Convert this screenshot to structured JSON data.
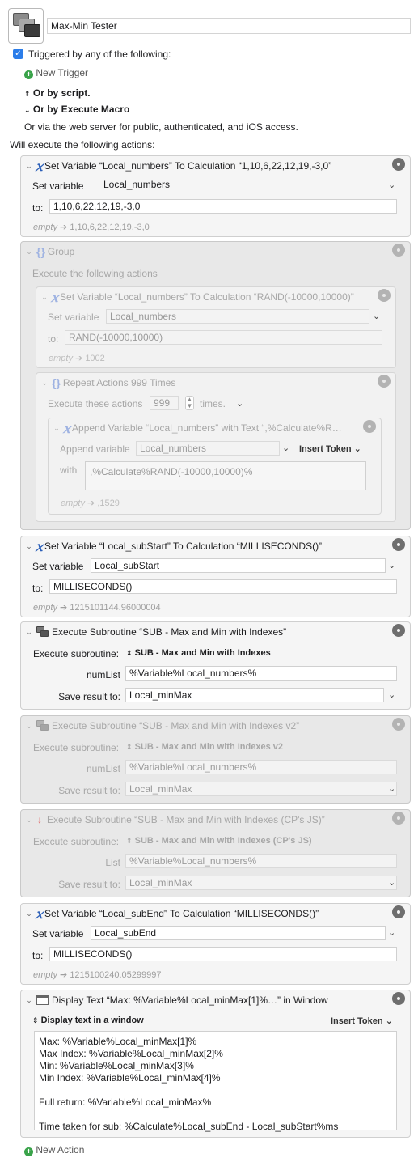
{
  "macro": {
    "name": "Max-Min Tester"
  },
  "triggers": {
    "header": "Triggered by any of the following:",
    "new_trigger": "New Trigger",
    "by_script": "Or by script.",
    "by_execute_macro": "Or by Execute Macro",
    "web_server": "Or via the web server for public, authenticated, and iOS access."
  },
  "actions_header": "Will execute the following actions:",
  "a1": {
    "title": "Set Variable “Local_numbers” To Calculation “1,10,6,22,12,19,-3,0”",
    "set_variable_label": "Set variable",
    "variable": "Local_numbers",
    "to_label": "to:",
    "value": "1,10,6,22,12,19,-3,0",
    "result_prefix": "empty",
    "result": "1,10,6,22,12,19,-3,0"
  },
  "group": {
    "title": "Group",
    "subtitle": "Execute the following actions",
    "g1": {
      "title": "Set Variable “Local_numbers” To Calculation “RAND(-10000,10000)”",
      "set_variable_label": "Set variable",
      "variable": "Local_numbers",
      "to_label": "to:",
      "value": "RAND(-10000,10000)",
      "result_prefix": "empty",
      "result": "1002"
    },
    "repeat": {
      "title": "Repeat Actions 999 Times",
      "label": "Execute these actions",
      "count": "999",
      "times": "times.",
      "append": {
        "title": "Append Variable “Local_numbers” with Text “,%Calculate%R…",
        "append_label": "Append variable",
        "variable": "Local_numbers",
        "insert_token": "Insert Token",
        "with_label": "with",
        "text": ",%Calculate%RAND(-10000,10000)%",
        "result_prefix": "empty",
        "result": ",1529"
      }
    }
  },
  "a3": {
    "title": "Set Variable “Local_subStart” To Calculation “MILLISECONDS()”",
    "set_variable_label": "Set variable",
    "variable": "Local_subStart",
    "to_label": "to:",
    "value": "MILLISECONDS()",
    "result_prefix": "empty",
    "result": "1215101144.96000004"
  },
  "a4": {
    "title": "Execute Subroutine “SUB - Max and Min with Indexes”",
    "exec_label": "Execute subroutine:",
    "subroutine": "SUB - Max and Min with Indexes",
    "param_label": "numList",
    "param_value": "%Variable%Local_numbers%",
    "save_label": "Save result to:",
    "save_value": "Local_minMax"
  },
  "a5": {
    "title": "Execute Subroutine “SUB - Max and Min with Indexes v2”",
    "exec_label": "Execute subroutine:",
    "subroutine": "SUB - Max and Min with Indexes v2",
    "param_label": "numList",
    "param_value": "%Variable%Local_numbers%",
    "save_label": "Save result to:",
    "save_value": "Local_minMax"
  },
  "a6": {
    "title": "Execute Subroutine “SUB - Max and Min with Indexes (CP's JS)”",
    "exec_label": "Execute subroutine:",
    "subroutine": "SUB - Max and Min with Indexes (CP's JS)",
    "param_label": "List",
    "param_value": "%Variable%Local_numbers%",
    "save_label": "Save result to:",
    "save_value": "Local_minMax"
  },
  "a7": {
    "title": "Set Variable “Local_subEnd” To Calculation “MILLISECONDS()”",
    "set_variable_label": "Set variable",
    "variable": "Local_subEnd",
    "to_label": "to:",
    "value": "MILLISECONDS()",
    "result_prefix": "empty",
    "result": "1215100240.05299997"
  },
  "a8": {
    "title": "Display Text “Max: %Variable%Local_minMax[1]%…” in Window",
    "mode": "Display text in a window",
    "insert_token": "Insert Token",
    "text": "Max: %Variable%Local_minMax[1]%\nMax Index: %Variable%Local_minMax[2]%\nMin: %Variable%Local_minMax[3]%\nMin Index: %Variable%Local_minMax[4]%\n\nFull return: %Variable%Local_minMax%\n\nTime taken for sub: %Calculate%Local_subEnd - Local_subStart%ms"
  },
  "new_action": "New Action"
}
